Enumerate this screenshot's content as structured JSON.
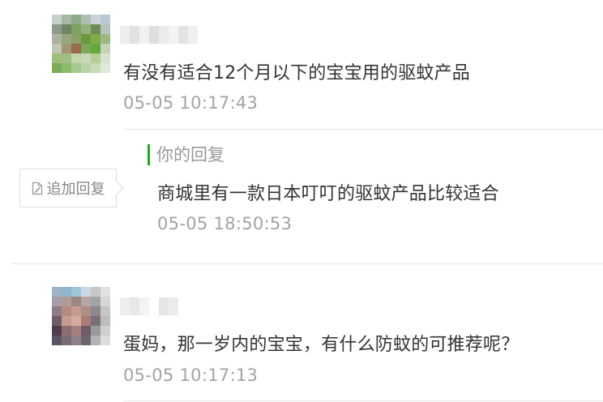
{
  "comments": [
    {
      "text": "有没有适合12个月以下的宝宝用的驱蚊产品",
      "time": "05-05 10:17:43",
      "reply": {
        "label": "你的回复",
        "text": "商城里有一款日本叮叮的驱蚊产品比较适合",
        "time": "05-05 18:50:53"
      },
      "add_reply_label": "追加回复"
    },
    {
      "text": "蛋妈，那一岁内的宝宝，有什么防蚊的可推荐呢？",
      "time": "05-05 10:17:13"
    }
  ],
  "colors": {
    "reply_accent": "#1aad19",
    "timestamp": "#a3a3a3",
    "text": "#333333"
  },
  "icons": {
    "add_reply": "edit-icon"
  }
}
